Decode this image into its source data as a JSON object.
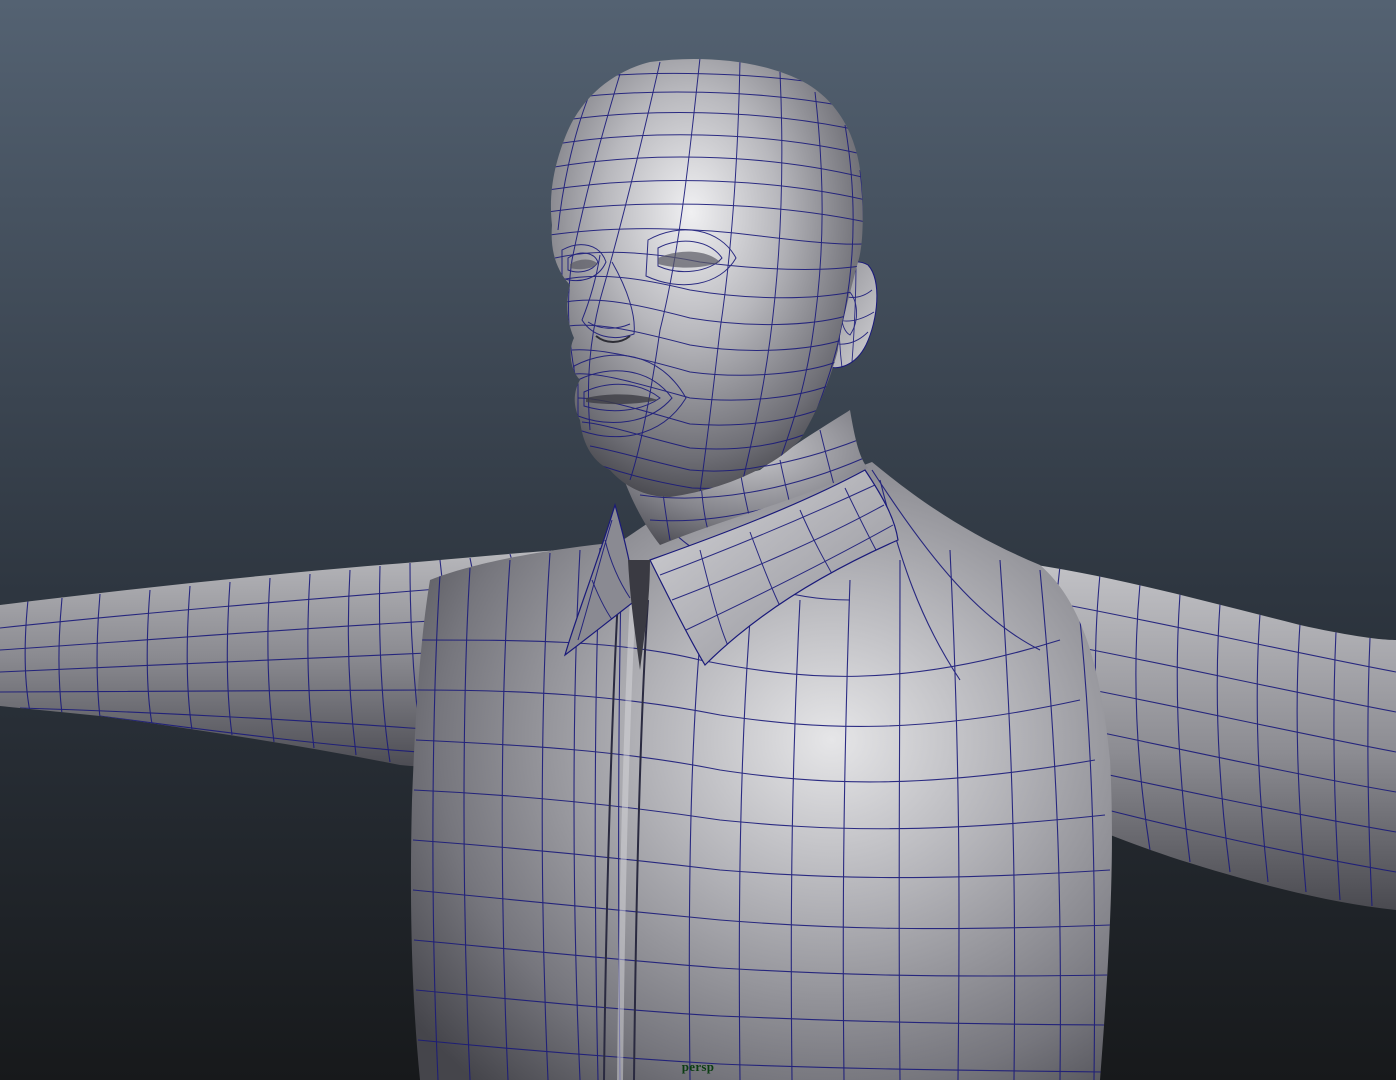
{
  "viewport": {
    "camera_name": "persp",
    "camera_label_color": "#0b3d12",
    "background_top_color": "#546272",
    "background_bottom_color": "#17191b",
    "wireframe_color": "#1a1a7a",
    "model_description_icon": "wireframe-on-shaded-mesh"
  }
}
